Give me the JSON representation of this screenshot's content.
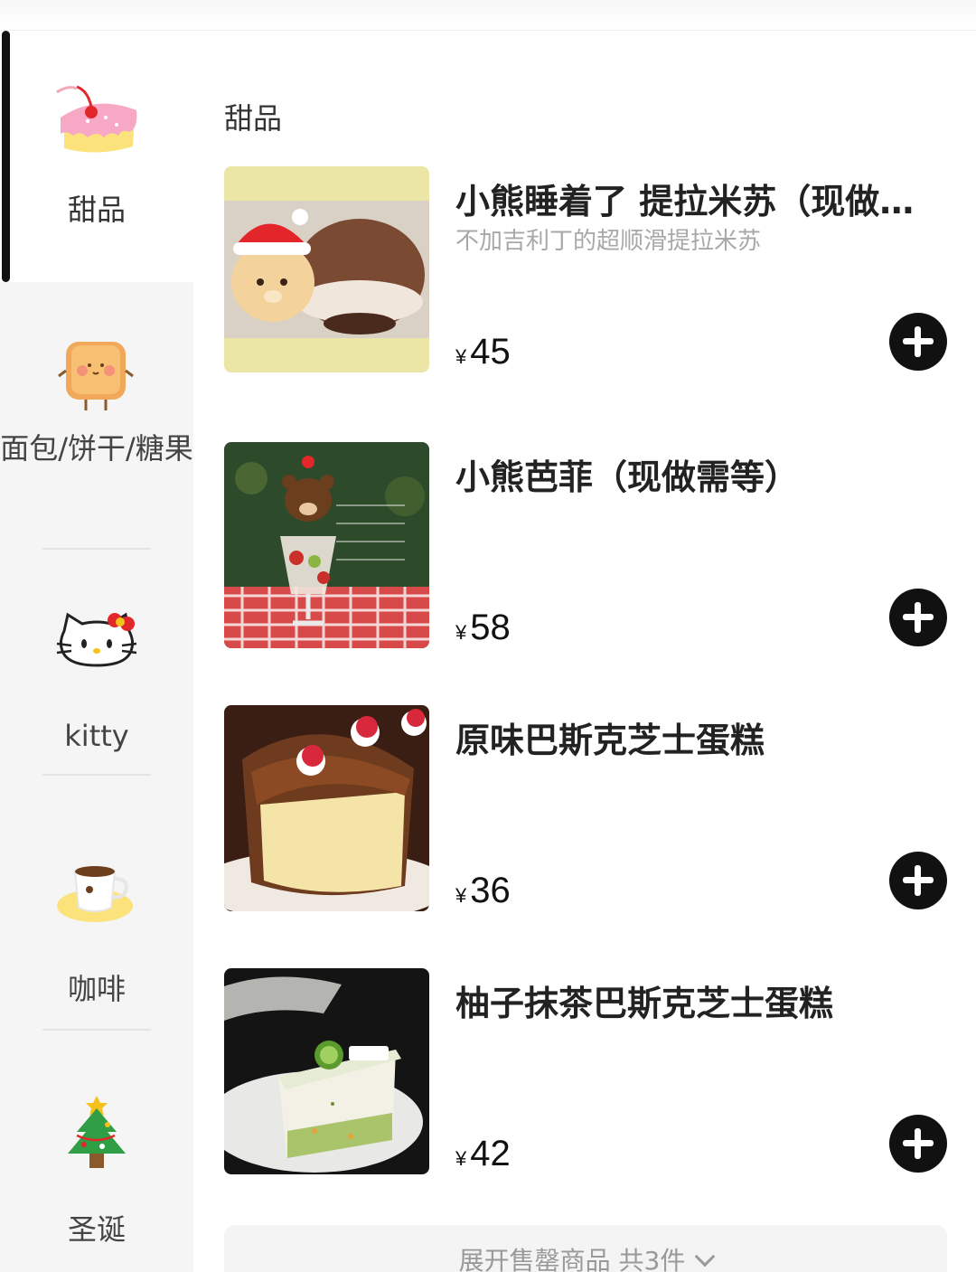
{
  "sidebar": {
    "categories": [
      {
        "label": "甜品",
        "icon": "cake-icon",
        "active": true
      },
      {
        "label": "面包/饼干/糖果",
        "icon": "bread-icon",
        "active": false
      },
      {
        "label": "kitty",
        "icon": "hello-kitty-icon",
        "active": false
      },
      {
        "label": "咖啡",
        "icon": "coffee-cup-icon",
        "active": false
      },
      {
        "label": "圣诞",
        "icon": "christmas-tree-icon",
        "active": false
      }
    ]
  },
  "main": {
    "section_title": "甜品",
    "items": [
      {
        "name": "小熊睡着了 提拉米苏（现做…",
        "desc": "不加吉利丁的超顺滑提拉米苏",
        "currency": "¥",
        "price": "45"
      },
      {
        "name": "小熊芭菲（现做需等）",
        "desc": "",
        "currency": "¥",
        "price": "58"
      },
      {
        "name": "原味巴斯克芝士蛋糕",
        "desc": "",
        "currency": "¥",
        "price": "36"
      },
      {
        "name": "柚子抹茶巴斯克芝士蛋糕",
        "desc": "",
        "currency": "¥",
        "price": "42"
      }
    ],
    "expand_label": "展开售罄商品 共3件"
  },
  "colors": {
    "accent": "#111111",
    "sidebar_bg": "#f5f5f5",
    "muted_text": "#a8a8a8"
  }
}
